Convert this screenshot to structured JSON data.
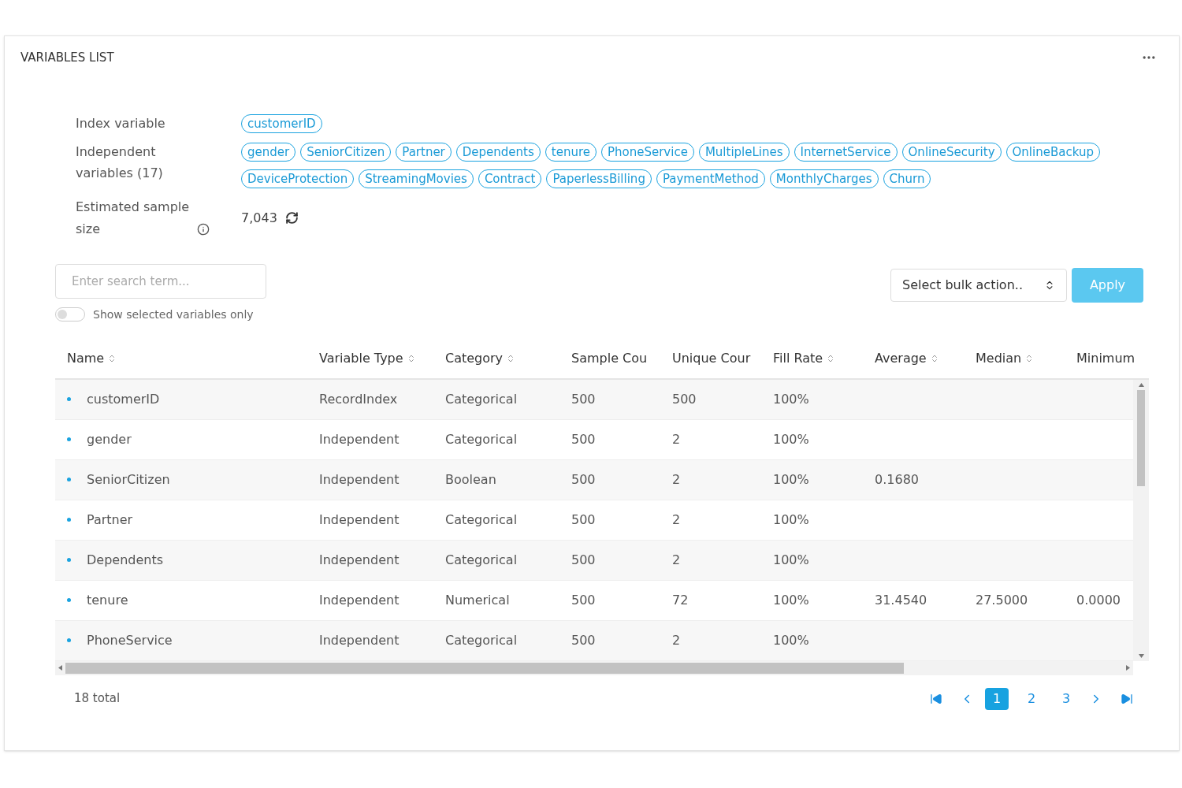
{
  "panel": {
    "title": "VARIABLES LIST"
  },
  "summary": {
    "index_label": "Index variable",
    "index_tags": [
      "customerID"
    ],
    "independent_label": "Independent variables (17)",
    "independent_tags": [
      "gender",
      "SeniorCitizen",
      "Partner",
      "Dependents",
      "tenure",
      "PhoneService",
      "MultipleLines",
      "InternetService",
      "OnlineSecurity",
      "OnlineBackup",
      "DeviceProtection",
      "StreamingMovies",
      "Contract",
      "PaperlessBilling",
      "PaymentMethod",
      "MonthlyCharges",
      "Churn"
    ],
    "sample_label": "Estimated sample size",
    "sample_value": "7,043"
  },
  "search": {
    "placeholder": "Enter search term..."
  },
  "toggle": {
    "label": "Show selected variables only",
    "on": false
  },
  "bulk_action": {
    "value": "Select bulk action..",
    "apply": "Apply"
  },
  "table": {
    "columns": [
      {
        "label": "Name",
        "sortable": true
      },
      {
        "label": "Variable Type",
        "sortable": true
      },
      {
        "label": "Category",
        "sortable": true
      },
      {
        "label": "Sample Cou",
        "sortable": false
      },
      {
        "label": "Unique Cour",
        "sortable": false
      },
      {
        "label": "Fill Rate",
        "sortable": true
      },
      {
        "label": "Average",
        "sortable": true
      },
      {
        "label": "Median",
        "sortable": true
      },
      {
        "label": "Minimum",
        "sortable": false
      }
    ],
    "rows": [
      {
        "cells": [
          "customerID",
          "RecordIndex",
          "Categorical",
          "500",
          "500",
          "100%"
        ]
      },
      {
        "cells": [
          "gender",
          "Independent",
          "Categorical",
          "500",
          "2",
          "100%"
        ]
      },
      {
        "cells": [
          "SeniorCitizen",
          "Independent",
          "Boolean",
          "500",
          "2",
          "100%",
          "0.1680"
        ]
      },
      {
        "cells": [
          "Partner",
          "Independent",
          "Categorical",
          "500",
          "2",
          "100%"
        ]
      },
      {
        "cells": [
          "Dependents",
          "Independent",
          "Categorical",
          "500",
          "2",
          "100%"
        ]
      },
      {
        "cells": [
          "tenure",
          "Independent",
          "Numerical",
          "500",
          "72",
          "100%",
          "31.4540",
          "27.5000",
          "0.0000"
        ]
      },
      {
        "cells": [
          "PhoneService",
          "Independent",
          "Categorical",
          "500",
          "2",
          "100%"
        ]
      }
    ]
  },
  "footer": {
    "total": "18 total",
    "pages": [
      {
        "label": "1",
        "selected": true
      },
      {
        "label": "2",
        "selected": false
      },
      {
        "label": "3",
        "selected": false
      }
    ]
  }
}
